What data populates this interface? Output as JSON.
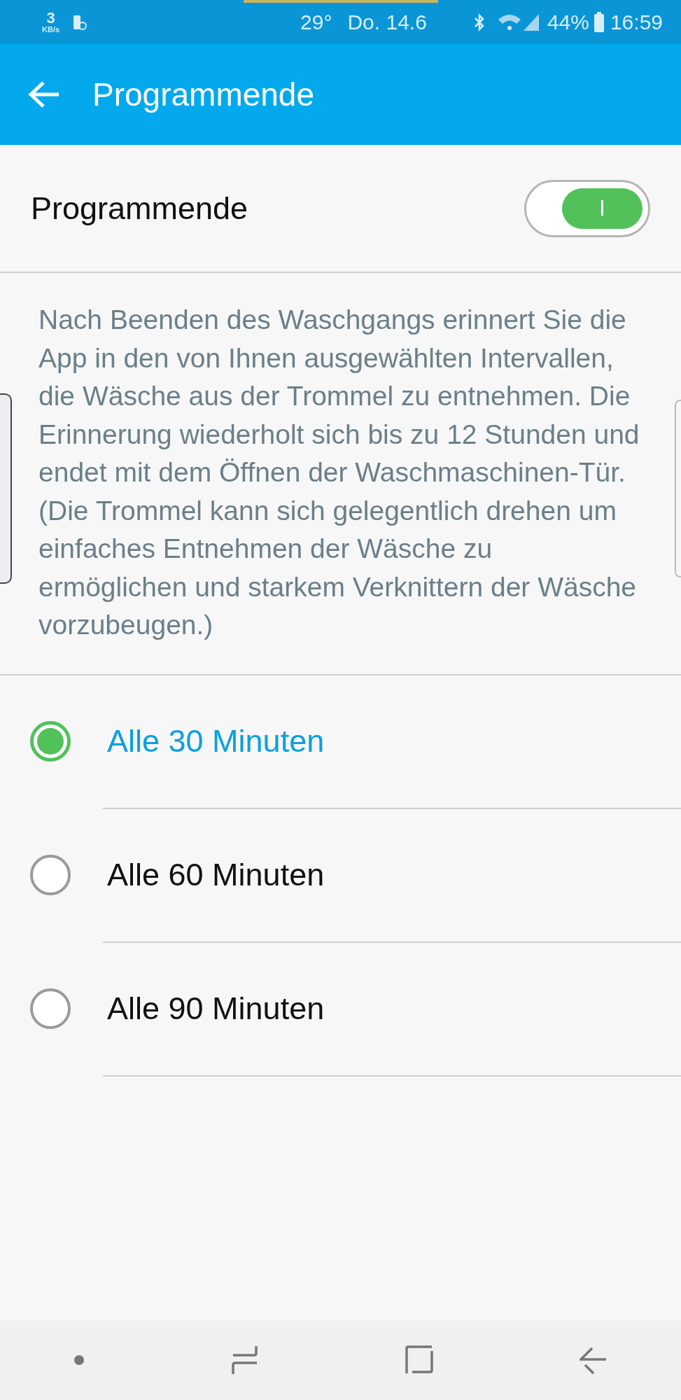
{
  "status_bar": {
    "speed_value": "3",
    "speed_unit": "KB/s",
    "weather": "29°",
    "date": "Do. 14.6",
    "battery": "44%",
    "time": "16:59"
  },
  "app_bar": {
    "title": "Programmende"
  },
  "setting": {
    "label": "Programmende",
    "on": true,
    "switch_mark": "I"
  },
  "description": "Nach Beenden des Waschgangs erinnert Sie die App in den von Ihnen ausgewählten Intervallen, die Wäsche aus der Trommel zu entnehmen. Die Erinnerung wiederholt sich bis zu 12 Stunden und endet mit dem Öffnen der Waschmaschinen-Tür.\n(Die Trommel kann sich gelegentlich drehen um einfaches Entnehmen der Wäsche zu ermöglichen und starkem Verknittern der Wäsche vorzubeugen.)",
  "options": [
    {
      "label": "Alle 30 Minuten",
      "selected": true
    },
    {
      "label": "Alle 60 Minuten",
      "selected": false
    },
    {
      "label": "Alle 90 Minuten",
      "selected": false
    }
  ]
}
